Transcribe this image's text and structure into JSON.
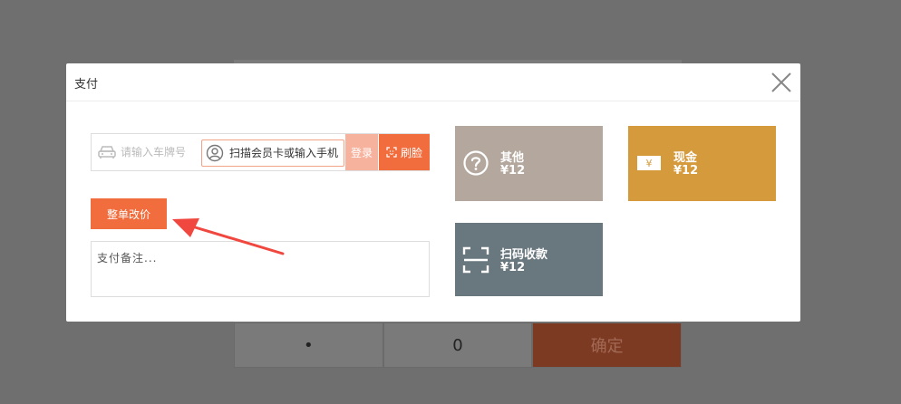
{
  "background": {
    "keypad": {
      "dot": "•",
      "zero": "0",
      "confirm": "确定"
    }
  },
  "modal": {
    "title": "支付",
    "plate_placeholder": "请输入车牌号",
    "member_placeholder": "扫描会员卡或输入手机",
    "login_label": "登录",
    "face_label": "刷脸",
    "adjust_label": "整单改价",
    "note_placeholder": "支付备注..."
  },
  "payments": [
    {
      "label": "其他",
      "amount": "¥12",
      "icon": "question-circle-icon",
      "color": "#b4a89e"
    },
    {
      "label": "现金",
      "amount": "¥12",
      "icon": "cash-icon",
      "color": "#d49a3c"
    },
    {
      "label": "扫码收款",
      "amount": "¥12",
      "icon": "scan-icon",
      "color": "#69777f"
    }
  ],
  "colors": {
    "accent": "#f26d3d",
    "accent_light": "#f7b29d",
    "annotation": "#f0473f"
  }
}
